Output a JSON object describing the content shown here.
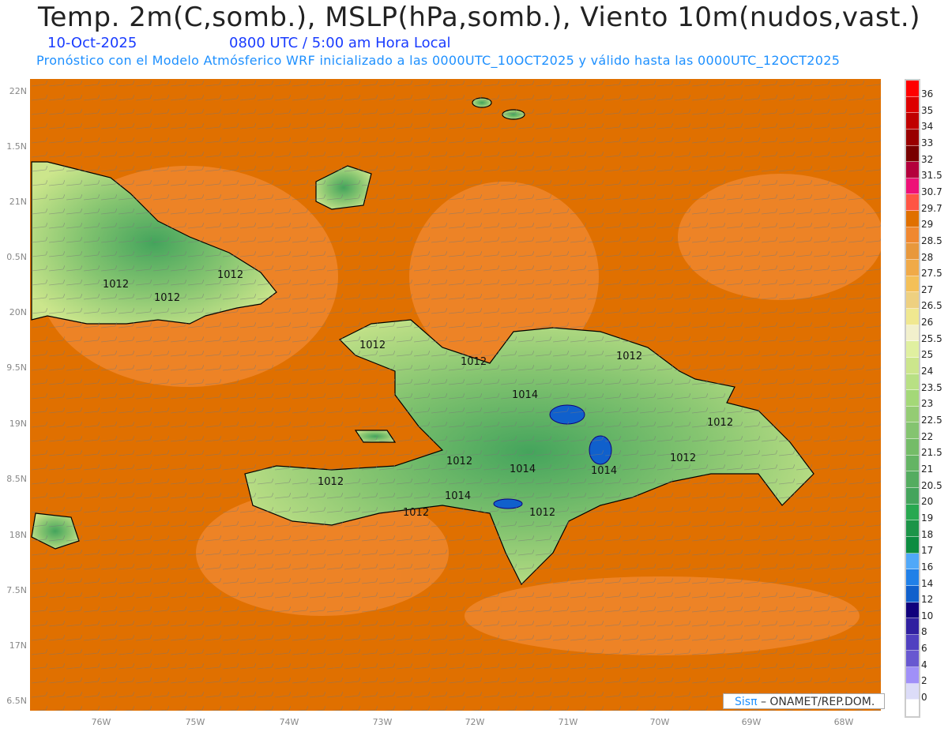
{
  "header": {
    "title": "Temp. 2m(C,somb.), MSLP(hPa,somb.), Viento 10m(nudos,vast.)",
    "date": "10-Oct-2025",
    "time": "0800 UTC / 5:00 am Hora Local",
    "description": "Pronóstico con el Modelo Atmósferico WRF inicializado a las 0000UTC_10OCT2025 y válido hasta las  0000UTC_12OCT2025"
  },
  "axes": {
    "lat_labels": [
      "22N",
      "1.5N",
      "21N",
      "0.5N",
      "20N",
      "9.5N",
      "19N",
      "8.5N",
      "18N",
      "7.5N",
      "17N",
      "6.5N"
    ],
    "lon_labels": [
      "76W",
      "75W",
      "74W",
      "73W",
      "72W",
      "71W",
      "70W",
      "69W",
      "68W"
    ]
  },
  "isobars": [
    "1012",
    "1012",
    "1012",
    "1012",
    "1012",
    "1012",
    "1014",
    "1014",
    "1014",
    "1012",
    "1014",
    "1012",
    "1012",
    "1012",
    "1012",
    "1012"
  ],
  "colorbar": {
    "labels": [
      "36",
      "35",
      "34",
      "33",
      "32",
      "31.5",
      "30.7",
      "29.7",
      "29",
      "28.5",
      "28",
      "27.5",
      "27",
      "26.5",
      "26",
      "25.5",
      "25",
      "24",
      "23.5",
      "23",
      "22.5",
      "22",
      "21.5",
      "21",
      "20.5",
      "20",
      "19",
      "18",
      "17",
      "16",
      "14",
      "12",
      "10",
      "8",
      "6",
      "4",
      "2",
      "0"
    ],
    "colors": [
      "#ff0000",
      "#dd0000",
      "#c00000",
      "#990000",
      "#780000",
      "#b4003c",
      "#ee1177",
      "#ff5544",
      "#e07000",
      "#f08830",
      "#e8983c",
      "#f0aa48",
      "#f4c058",
      "#eed080",
      "#f0e890",
      "#f2f0cc",
      "#e0f0a0",
      "#cce68c",
      "#b8e084",
      "#a4d878",
      "#94cc74",
      "#84c470",
      "#74bc68",
      "#64b464",
      "#54ac60",
      "#44a45c",
      "#28a850",
      "#1c9448",
      "#0c8c40",
      "#50a8f8",
      "#2080e8",
      "#1060cc",
      "#10007c",
      "#3020a0",
      "#5040c0",
      "#6858d0",
      "#a090f8",
      "#dcdcf8",
      "#ffffff"
    ]
  },
  "credit": {
    "brand": "Sisπ",
    "text": " – ONAMET/REP.DOM."
  }
}
